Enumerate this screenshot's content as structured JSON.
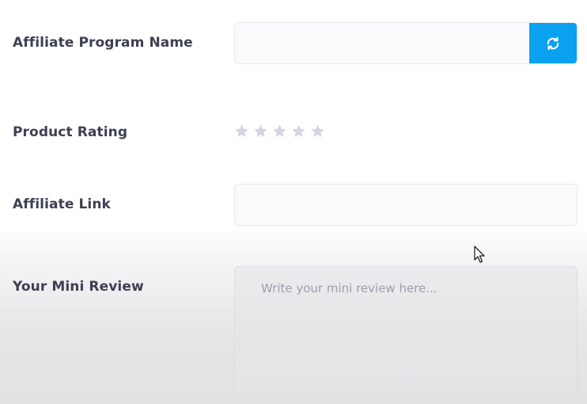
{
  "form": {
    "affiliate_program_name_label": "Affiliate Program Name",
    "product_rating_label": "Product Rating",
    "affiliate_link_label": "Affiliate Link",
    "mini_review_label": "Your Mini Review",
    "mini_review_placeholder": "Write your mini review here...",
    "affiliate_program_name_value": "",
    "affiliate_link_value": "",
    "rating": {
      "value": 0,
      "max": 5
    }
  },
  "icons": {
    "refresh_button": "refresh-icon",
    "star": "star-icon",
    "cursor": "mouse-pointer-icon"
  },
  "colors": {
    "accent": "#0aa2f0",
    "label_text": "#3d3f52",
    "star_empty": "#d6d6e2",
    "placeholder_text": "#9d9db0"
  }
}
